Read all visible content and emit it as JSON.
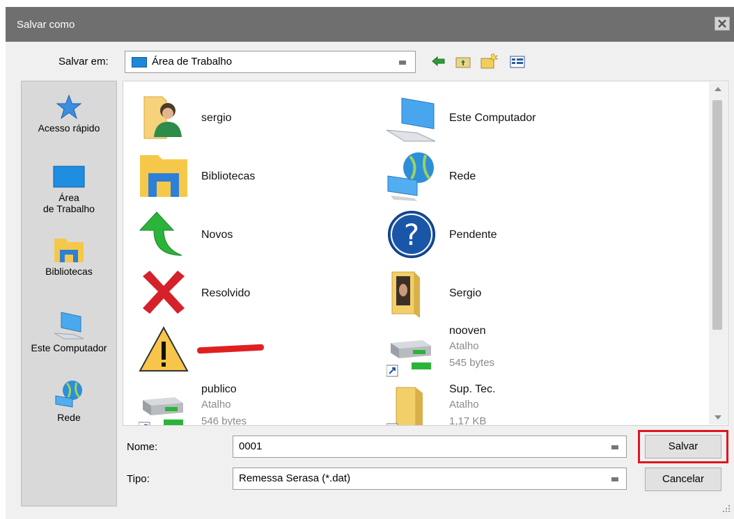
{
  "dialog": {
    "title": "Salvar como",
    "close_icon": "close-icon"
  },
  "toolbar": {
    "save_in_label": "Salvar em:",
    "location_value": "Área de Trabalho",
    "icons": [
      "back-arrow-icon",
      "up-folder-icon",
      "new-folder-icon",
      "view-menu-icon"
    ]
  },
  "places": [
    {
      "label": "Acesso rápido",
      "icon": "star-icon"
    },
    {
      "label_line1": "Área",
      "label_line2": "de Trabalho",
      "icon": "desktop-icon"
    },
    {
      "label": "Bibliotecas",
      "icon": "libraries-icon"
    },
    {
      "label": "Este Computador",
      "icon": "computer-icon"
    },
    {
      "label": "Rede",
      "icon": "network-icon"
    }
  ],
  "files": [
    {
      "name": "sergio",
      "icon": "user-folder-icon"
    },
    {
      "name": "Este Computador",
      "icon": "computer-icon"
    },
    {
      "name": "Bibliotecas",
      "icon": "libraries-folder-icon"
    },
    {
      "name": "Rede",
      "icon": "network-icon"
    },
    {
      "name": "Novos",
      "icon": "green-arrow-icon"
    },
    {
      "name": "Pendente",
      "icon": "question-icon"
    },
    {
      "name": "Resolvido",
      "icon": "red-x-icon"
    },
    {
      "name": "Sergio",
      "icon": "photo-folder-icon"
    },
    {
      "name": "",
      "icon": "warning-icon",
      "redacted": true
    },
    {
      "name": "nooven",
      "type": "Atalho",
      "size": "545 bytes",
      "icon": "network-drive-shortcut-icon"
    },
    {
      "name": "publico",
      "type": "Atalho",
      "size": "546 bytes",
      "icon": "network-drive-shortcut-icon"
    },
    {
      "name": "Sup. Tec.",
      "type": "Atalho",
      "size": "1,17 KB",
      "icon": "folder-shortcut-icon"
    }
  ],
  "form": {
    "name_label": "Nome:",
    "name_value": "0001",
    "type_label": "Tipo:",
    "type_value": "Remessa Serasa (*.dat)"
  },
  "buttons": {
    "save": "Salvar",
    "cancel": "Cancelar"
  },
  "colors": {
    "titlebar": "#6f6f6f",
    "highlight": "#e0151e",
    "folder": "#f6c84a"
  }
}
